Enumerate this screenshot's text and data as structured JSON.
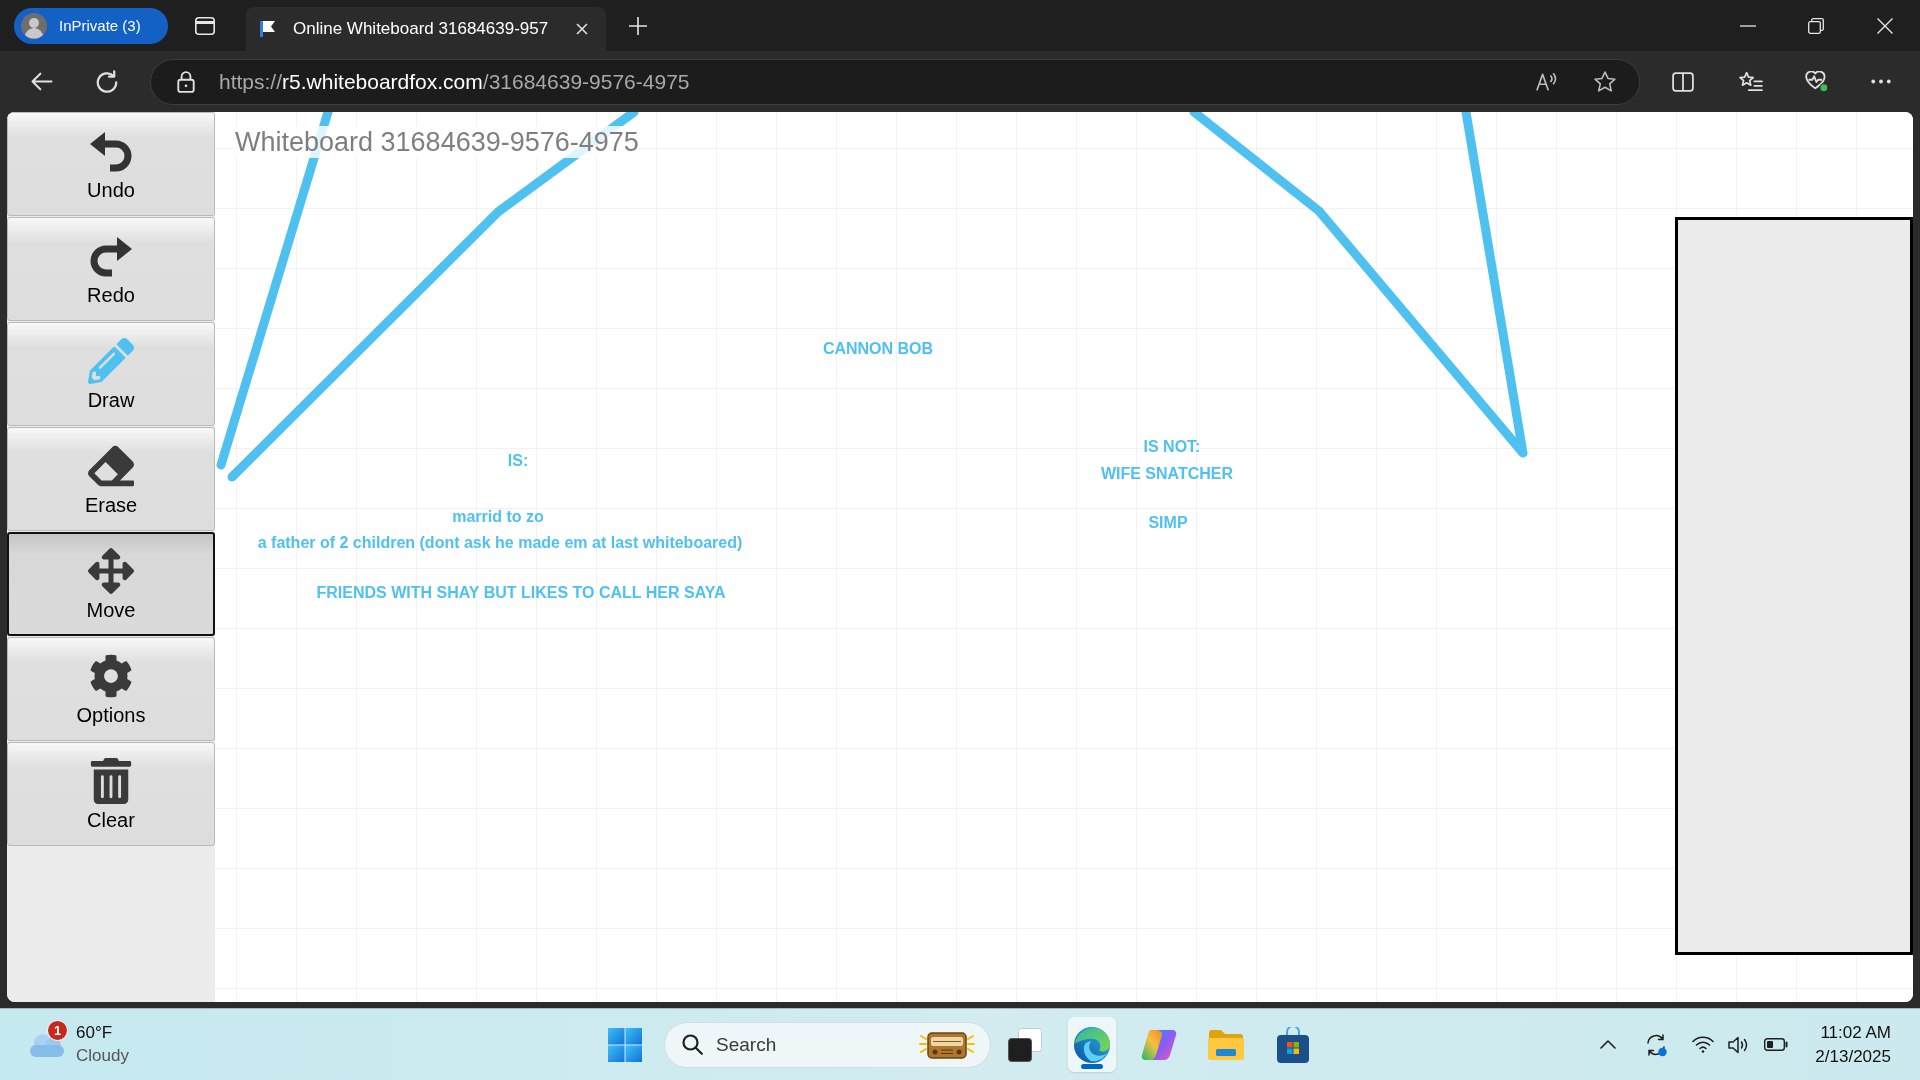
{
  "browser": {
    "profile": {
      "label": "InPrivate (3)"
    },
    "tabs": [
      {
        "title": "Online Whiteboard 31684639-957",
        "selected": true
      }
    ],
    "address_bar": {
      "scheme": "https://",
      "host": "r5.whiteboardfox.com",
      "path": "/31684639-9576-4975"
    }
  },
  "toolbar": {
    "tools": [
      {
        "kind": "undo",
        "label": "Undo",
        "selected": false
      },
      {
        "kind": "redo",
        "label": "Redo",
        "selected": false
      },
      {
        "kind": "draw",
        "label": "Draw",
        "selected": false
      },
      {
        "kind": "erase",
        "label": "Erase",
        "selected": false
      },
      {
        "kind": "move",
        "label": "Move",
        "selected": true
      },
      {
        "kind": "options",
        "label": "Options",
        "selected": false
      },
      {
        "kind": "clear",
        "label": "Clear",
        "selected": false
      }
    ]
  },
  "whiteboard": {
    "title": "Whiteboard 31684639-9576-4975",
    "notes": [
      "CANNON BOB",
      "IS:",
      "marrid to zo",
      "a father of 2 children (dont ask he made em at last whiteboared)",
      "FRIENDS WITH SHAY BUT LIKES TO CALL HER SAYA",
      "IS NOT:",
      "WIFE SNATCHER",
      "SIMP"
    ]
  },
  "taskbar": {
    "weather": {
      "badge": "1",
      "temperature": "60°F",
      "condition": "Cloudy"
    },
    "search": {
      "placeholder": "Search"
    },
    "apps": [
      {
        "kind": "task_view",
        "active": false
      },
      {
        "kind": "browser",
        "active": true
      },
      {
        "kind": "assistant",
        "active": false
      },
      {
        "kind": "files",
        "active": false
      },
      {
        "kind": "store",
        "active": false
      }
    ],
    "clock": {
      "time": "11:02 AM",
      "date": "2/13/2025"
    }
  }
}
